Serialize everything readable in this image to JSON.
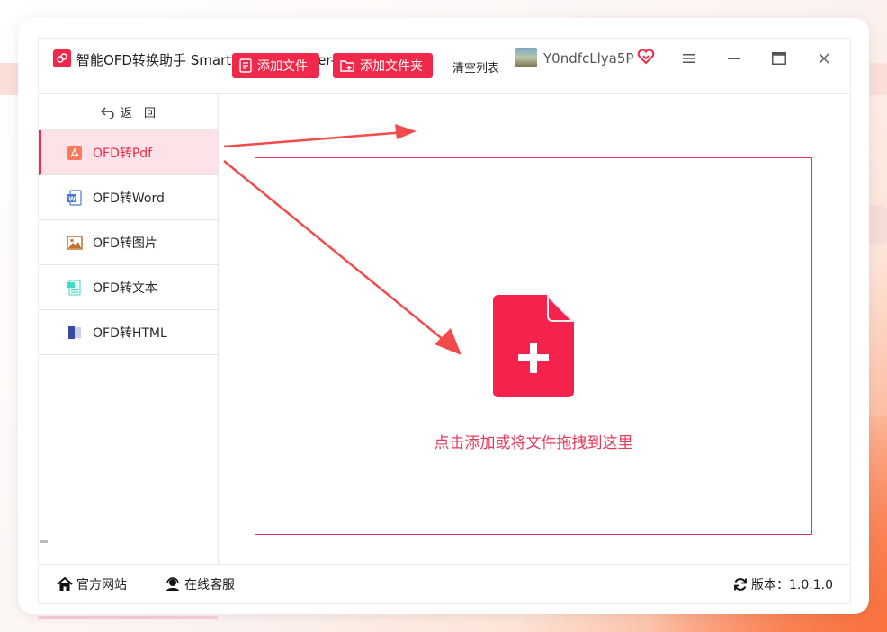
{
  "app": {
    "title": "智能OFD转换助手 SmartOFD Converter-OFD转文件",
    "username": "Y0ndfcLlya5P"
  },
  "sidebar": {
    "back_label": "返　回",
    "items": [
      {
        "label": "OFD转Pdf",
        "icon": "pdf-icon",
        "active": true
      },
      {
        "label": "OFD转Word",
        "icon": "word-icon",
        "active": false
      },
      {
        "label": "OFD转图片",
        "icon": "image-icon",
        "active": false
      },
      {
        "label": "OFD转文本",
        "icon": "text-icon",
        "active": false
      },
      {
        "label": "OFD转HTML",
        "icon": "html-icon",
        "active": false
      }
    ]
  },
  "toolbar": {
    "add_file": "添加文件",
    "add_folder": "添加文件夹",
    "clear_list": "清空列表"
  },
  "dropzone": {
    "hint": "点击添加或将文件拖拽到这里"
  },
  "footer": {
    "website": "官方网站",
    "service": "在线客服",
    "version_label": "版本：1.0.1.0"
  },
  "colors": {
    "accent": "#f0284a",
    "dropzone_text": "#e63a5e",
    "active_bg": "#fde3e7"
  }
}
